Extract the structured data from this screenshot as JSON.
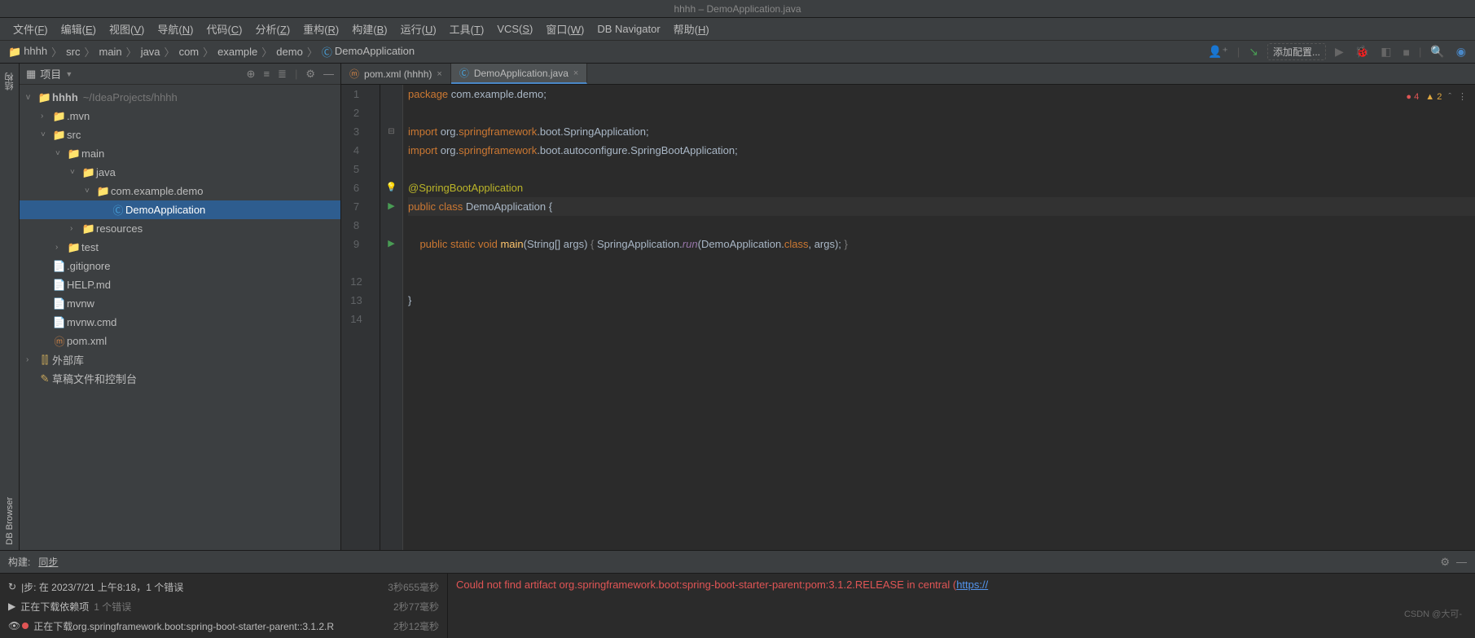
{
  "window_title": "hhhh – DemoApplication.java",
  "menubar": [
    {
      "label": "文件",
      "key": "F"
    },
    {
      "label": "编辑",
      "key": "E"
    },
    {
      "label": "视图",
      "key": "V"
    },
    {
      "label": "导航",
      "key": "N"
    },
    {
      "label": "代码",
      "key": "C"
    },
    {
      "label": "分析",
      "key": "Z"
    },
    {
      "label": "重构",
      "key": "R"
    },
    {
      "label": "构建",
      "key": "B"
    },
    {
      "label": "运行",
      "key": "U"
    },
    {
      "label": "工具",
      "key": "T"
    },
    {
      "label": "VCS",
      "key": "S"
    },
    {
      "label": "窗口",
      "key": "W"
    },
    {
      "label": "DB Navigator",
      "key": ""
    },
    {
      "label": "帮助",
      "key": "H"
    }
  ],
  "breadcrumbs": [
    "hhhh",
    "src",
    "main",
    "java",
    "com",
    "example",
    "demo",
    "DemoApplication"
  ],
  "run_config": "添加配置...",
  "project_panel": {
    "title": "项目",
    "root": {
      "name": "hhhh",
      "hint": "~/IdeaProjects/hhhh"
    },
    "tree": [
      {
        "indent": 1,
        "arrow": ">",
        "icon": "folder",
        "label": ".mvn"
      },
      {
        "indent": 1,
        "arrow": "v",
        "icon": "folder-src",
        "label": "src"
      },
      {
        "indent": 2,
        "arrow": "v",
        "icon": "folder-src",
        "label": "main"
      },
      {
        "indent": 3,
        "arrow": "v",
        "icon": "folder-src",
        "label": "java"
      },
      {
        "indent": 4,
        "arrow": "v",
        "icon": "folder-pkg",
        "label": "com.example.demo"
      },
      {
        "indent": 5,
        "arrow": "",
        "icon": "jclass",
        "label": "DemoApplication",
        "selected": true
      },
      {
        "indent": 3,
        "arrow": ">",
        "icon": "folder-res",
        "label": "resources"
      },
      {
        "indent": 2,
        "arrow": ">",
        "icon": "folder",
        "label": "test"
      },
      {
        "indent": 1,
        "arrow": "",
        "icon": "file",
        "label": ".gitignore"
      },
      {
        "indent": 1,
        "arrow": "",
        "icon": "file",
        "label": "HELP.md"
      },
      {
        "indent": 1,
        "arrow": "",
        "icon": "file",
        "label": "mvnw"
      },
      {
        "indent": 1,
        "arrow": "",
        "icon": "file",
        "label": "mvnw.cmd"
      },
      {
        "indent": 1,
        "arrow": "",
        "icon": "maven",
        "label": "pom.xml"
      }
    ],
    "extra": [
      {
        "indent": 0,
        "arrow": ">",
        "icon": "lib",
        "label": "外部库"
      },
      {
        "indent": 0,
        "arrow": "",
        "icon": "scratch",
        "label": "草稿文件和控制台"
      }
    ]
  },
  "gutter_tabs": {
    "structure": "结构",
    "db": "DB Browser"
  },
  "editor_tabs": [
    {
      "label": "pom.xml (hhhh)",
      "icon": "maven",
      "active": false
    },
    {
      "label": "DemoApplication.java",
      "icon": "jclass",
      "active": true
    }
  ],
  "inspector": {
    "errors": "4",
    "warnings": "2"
  },
  "code": {
    "lines": [
      1,
      2,
      3,
      4,
      5,
      6,
      7,
      8,
      9,
      "",
      "12",
      "13",
      "14"
    ],
    "content": [
      {
        "n": 1,
        "t": "package",
        "segs": [
          [
            "kw",
            "package "
          ],
          [
            "pkg",
            "com.example.demo"
          ],
          [
            "op",
            ";"
          ]
        ]
      },
      {
        "n": 2,
        "t": ""
      },
      {
        "n": 3,
        "t": "import",
        "segs": [
          [
            "kw",
            "import "
          ],
          [
            "pkg",
            "org."
          ],
          [
            "kw",
            "springframework"
          ],
          [
            "pkg",
            ".boot.SpringApplication"
          ],
          [
            "op",
            ";"
          ]
        ],
        "fold": "⊟"
      },
      {
        "n": 4,
        "t": "import",
        "segs": [
          [
            "kw",
            "import "
          ],
          [
            "pkg",
            "org."
          ],
          [
            "kw",
            "springframework"
          ],
          [
            "pkg",
            ".boot.autoconfigure.SpringBootApplication"
          ],
          [
            "op",
            ";"
          ]
        ]
      },
      {
        "n": 5,
        "t": ""
      },
      {
        "n": 6,
        "t": "ann",
        "segs": [
          [
            "ann",
            "@"
          ],
          [
            "ann",
            "SpringBootApplication"
          ]
        ],
        "bulb": true
      },
      {
        "n": 7,
        "t": "class",
        "segs": [
          [
            "kw",
            "public class "
          ],
          [
            "cls",
            "DemoApplication"
          ],
          [
            "op",
            " {"
          ]
        ],
        "run": true,
        "current": true
      },
      {
        "n": 8,
        "t": ""
      },
      {
        "n": 9,
        "t": "main",
        "segs": [
          [
            "",
            "    "
          ],
          [
            "kw",
            "public static "
          ],
          [
            "kw",
            "void "
          ],
          [
            "meth",
            "main"
          ],
          [
            "op",
            "(String[] args) "
          ],
          [
            "fade",
            "{ "
          ],
          [
            "cls",
            "SpringApplication"
          ],
          [
            "op",
            "."
          ],
          [
            "hw",
            "run"
          ],
          [
            "op",
            "("
          ],
          [
            "cls",
            "DemoApplication"
          ],
          [
            "op",
            "."
          ],
          [
            "kw",
            "class"
          ],
          [
            "op",
            ", args); "
          ],
          [
            "fade",
            "}"
          ]
        ],
        "run": true,
        "fold": "⊞"
      },
      {
        "n": "",
        "t": ""
      },
      {
        "n": 12,
        "t": ""
      },
      {
        "n": 13,
        "t": "close",
        "segs": [
          [
            "op",
            "}"
          ]
        ]
      },
      {
        "n": 14,
        "t": ""
      }
    ]
  },
  "build_tab": {
    "label": "构建:",
    "sync": "同步"
  },
  "build_rows": [
    {
      "icon": "reload",
      "text": "步: 在 2023/7/21 上午8:18，1 个错误",
      "time": "3秒655毫秒"
    },
    {
      "icon": "running",
      "text": "正在下载依赖项",
      "hint": "1 个错误",
      "time": "2秒77毫秒"
    },
    {
      "icon": "running-err",
      "text": "正在下载org.springframework.boot:spring-boot-starter-parent::3.1.2.R",
      "time": "2秒12毫秒"
    }
  ],
  "build_error": {
    "text": "Could not find artifact org.springframework.boot:spring-boot-starter-parent:pom:3.1.2.RELEASE in central (",
    "link": "https://"
  },
  "watermark": "CSDN @大可-"
}
